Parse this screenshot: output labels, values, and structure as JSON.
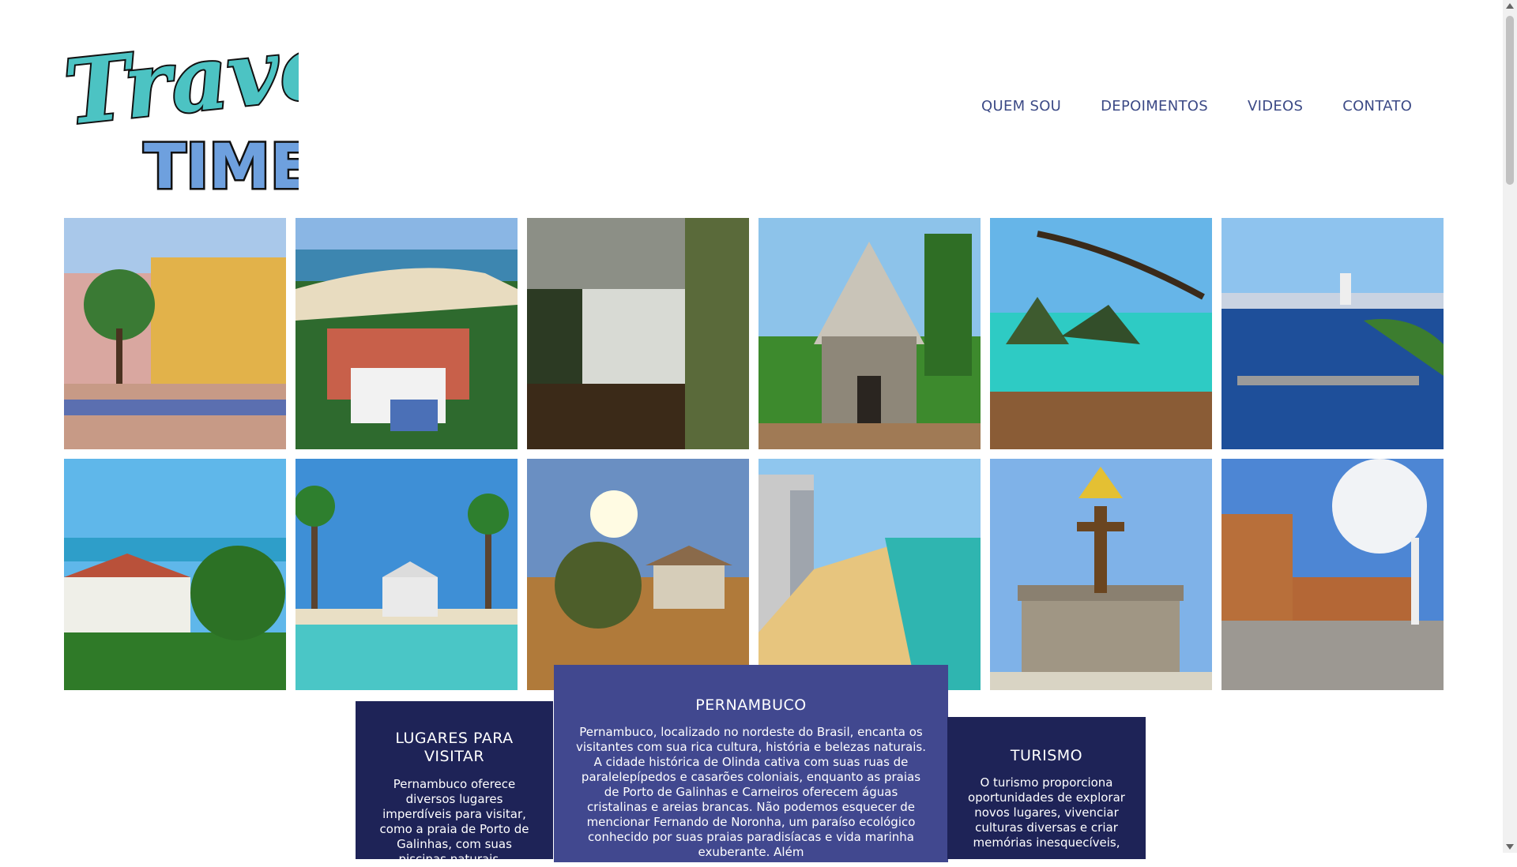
{
  "logo": {
    "line1": "Travel",
    "line2": "TIME!"
  },
  "nav": [
    "QUEM SOU",
    "DEPOIMENTOS",
    "VIDEOS",
    "CONTATO"
  ],
  "gallery": {
    "tiles": [
      {
        "name": "recife-old-town-photo",
        "icon": "colonial-buildings"
      },
      {
        "name": "olinda-coast-photo",
        "icon": "coastal-town"
      },
      {
        "name": "waterfall-photo",
        "icon": "waterfall"
      },
      {
        "name": "stone-chapel-photo",
        "icon": "chapel"
      },
      {
        "name": "noronha-bay-photo",
        "icon": "island-bay"
      },
      {
        "name": "recife-river-bridge-photo",
        "icon": "river-bridge"
      },
      {
        "name": "olinda-churches-photo",
        "icon": "palms-church"
      },
      {
        "name": "beach-church-photo",
        "icon": "beach-church"
      },
      {
        "name": "sertao-landscape-photo",
        "icon": "dry-landscape"
      },
      {
        "name": "boa-viagem-beach-photo",
        "icon": "urban-beach"
      },
      {
        "name": "cross-monument-photo",
        "icon": "cross-tower"
      },
      {
        "name": "fort-photo",
        "icon": "fort"
      }
    ]
  },
  "cards": {
    "left": {
      "title": "LUGARES PARA VISITAR",
      "text": "Pernambuco oferece diversos lugares imperdíveis para visitar, como a praia de Porto de Galinhas, com suas piscinas naturais..."
    },
    "center": {
      "title": "PERNAMBUCO",
      "text": "Pernambuco, localizado no nordeste do Brasil, encanta os visitantes com sua rica cultura, história e belezas naturais. A cidade histórica de Olinda cativa com suas ruas de paralelepípedos e casarões coloniais, enquanto as praias de Porto de Galinhas e Carneiros oferecem águas cristalinas e areias brancas. Não podemos esquecer de mencionar Fernando de Noronha, um paraíso ecológico conhecido por suas praias paradisíacas e vida marinha exuberante. Além"
    },
    "right": {
      "title": "TURISMO",
      "text": "O turismo proporciona oportunidades de explorar novos lugares, vivenciar culturas diversas e criar memórias inesquecíveis,"
    }
  },
  "colors": {
    "nav_text": "#3c4a86",
    "card_dark": "#1e2357",
    "card_mid": "#41488f",
    "logo_teal": "#4cc3c3",
    "logo_blue": "#6ea0de"
  }
}
